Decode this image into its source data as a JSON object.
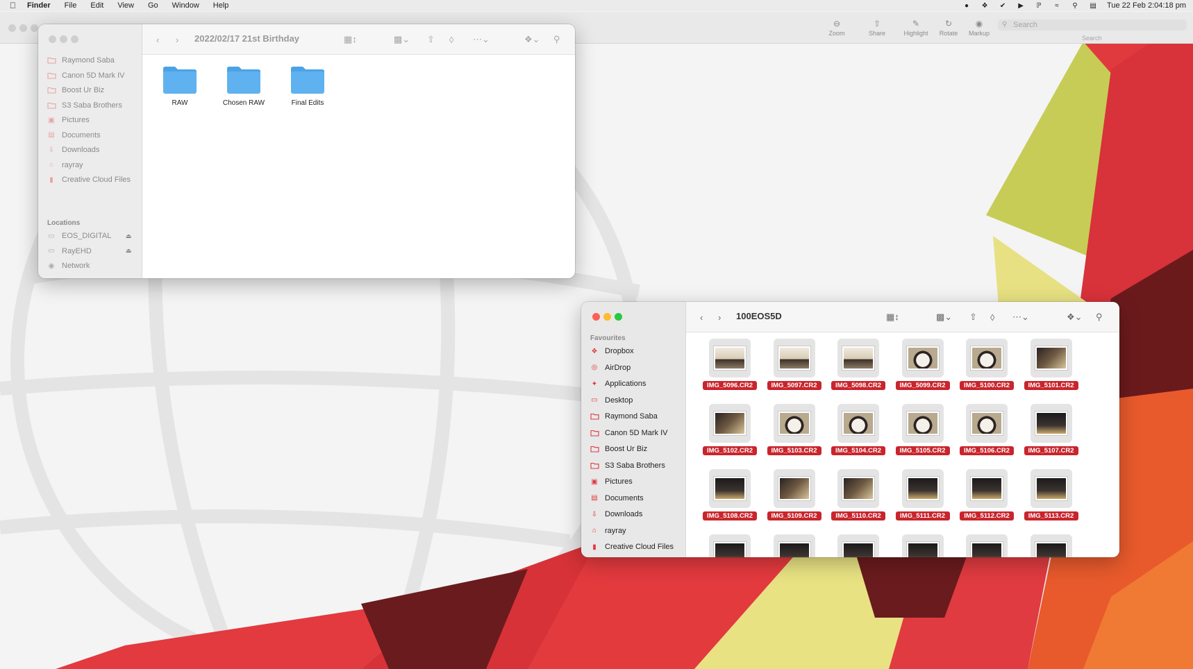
{
  "menubar": {
    "app_name": "Finder",
    "menus": [
      "File",
      "Edit",
      "View",
      "Go",
      "Window",
      "Help"
    ],
    "clock": "Tue 22 Feb  2:04:18 pm"
  },
  "preview_toolbar": {
    "tools": [
      "Zoom",
      "Share",
      "Highlight",
      "Rotate",
      "Markup"
    ],
    "search_placeholder": "Search",
    "search_label": "Search"
  },
  "finder_back": {
    "title": "2022/02/17 21st Birthday",
    "sidebar_items": [
      {
        "label": "Raymond Saba",
        "icon": "folder-icon"
      },
      {
        "label": "Canon 5D Mark IV",
        "icon": "folder-icon"
      },
      {
        "label": "Boost Ur Biz",
        "icon": "folder-icon"
      },
      {
        "label": "S3 Saba Brothers",
        "icon": "folder-icon"
      },
      {
        "label": "Pictures",
        "icon": "pictures-icon"
      },
      {
        "label": "Documents",
        "icon": "document-icon"
      },
      {
        "label": "Downloads",
        "icon": "download-icon"
      },
      {
        "label": "rayray",
        "icon": "home-icon"
      },
      {
        "label": "Creative Cloud Files",
        "icon": "file-icon"
      }
    ],
    "locations_header": "Locations",
    "locations": [
      {
        "label": "EOS_DIGITAL",
        "icon": "drive-icon",
        "eject": true
      },
      {
        "label": "RayEHD",
        "icon": "drive-icon",
        "eject": true
      },
      {
        "label": "Network",
        "icon": "globe-icon",
        "eject": false
      }
    ],
    "folders": [
      "RAW",
      "Chosen RAW",
      "Final Edits"
    ]
  },
  "finder_front": {
    "title": "100EOS5D",
    "favourites_header": "Favourites",
    "sidebar_items": [
      {
        "label": "Dropbox",
        "icon": "dropbox-icon"
      },
      {
        "label": "AirDrop",
        "icon": "airdrop-icon"
      },
      {
        "label": "Applications",
        "icon": "applications-icon"
      },
      {
        "label": "Desktop",
        "icon": "desktop-icon"
      },
      {
        "label": "Raymond Saba",
        "icon": "folder-icon"
      },
      {
        "label": "Canon 5D Mark IV",
        "icon": "folder-icon"
      },
      {
        "label": "Boost Ur Biz",
        "icon": "folder-icon"
      },
      {
        "label": "S3 Saba Brothers",
        "icon": "folder-icon"
      },
      {
        "label": "Pictures",
        "icon": "pictures-icon"
      },
      {
        "label": "Documents",
        "icon": "document-icon"
      },
      {
        "label": "Downloads",
        "icon": "download-icon"
      },
      {
        "label": "rayray",
        "icon": "home-icon"
      },
      {
        "label": "Creative Cloud Files",
        "icon": "file-icon"
      }
    ],
    "files": [
      "IMG_5096.CR2",
      "IMG_5097.CR2",
      "IMG_5098.CR2",
      "IMG_5099.CR2",
      "IMG_5100.CR2",
      "IMG_5101.CR2",
      "IMG_5102.CR2",
      "IMG_5103.CR2",
      "IMG_5104.CR2",
      "IMG_5105.CR2",
      "IMG_5106.CR2",
      "IMG_5107.CR2",
      "IMG_5108.CR2",
      "IMG_5109.CR2",
      "IMG_5110.CR2",
      "IMG_5111.CR2",
      "IMG_5112.CR2",
      "IMG_5113.CR2"
    ],
    "partial_row_count": 6
  },
  "colors": {
    "selection_label": "#c9252c",
    "close": "#ff5f57",
    "minimize": "#febc2e",
    "zoom": "#28c840",
    "folder_blue": "#5fb2ef",
    "sidebar_accent": "#e0373f"
  }
}
